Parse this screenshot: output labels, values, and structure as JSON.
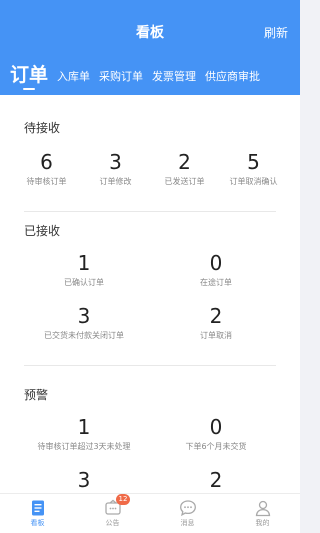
{
  "header": {
    "title": "看板",
    "right_action": "刷新"
  },
  "tabs": [
    {
      "label": "订单",
      "active": true
    },
    {
      "label": "入库单",
      "active": false
    },
    {
      "label": "采购订单",
      "active": false
    },
    {
      "label": "发票管理",
      "active": false
    },
    {
      "label": "供应商审批",
      "active": false
    }
  ],
  "pending": {
    "title": "待接收",
    "items": [
      {
        "value": "6",
        "label": "待审核订单"
      },
      {
        "value": "3",
        "label": "订单修改"
      },
      {
        "value": "2",
        "label": "已发送订单"
      },
      {
        "value": "5",
        "label": "订单取消确认"
      }
    ]
  },
  "received": {
    "title": "已接收",
    "items": [
      {
        "value": "1",
        "label": "已确认订单"
      },
      {
        "value": "0",
        "label": "在途订单"
      },
      {
        "value": "3",
        "label": "已交货未付款关闭订单"
      },
      {
        "value": "2",
        "label": "订单取消"
      }
    ]
  },
  "warning": {
    "title": "预警",
    "items": [
      {
        "value": "1",
        "label": "待审核订单超过3天未处理"
      },
      {
        "value": "0",
        "label": "下单6个月未交货"
      },
      {
        "value": "3",
        "label": ""
      },
      {
        "value": "2",
        "label": ""
      }
    ]
  },
  "bottom_nav": {
    "items": [
      {
        "label": "看板",
        "icon": "dashboard-icon",
        "active": true
      },
      {
        "label": "公告",
        "icon": "announcement-icon",
        "badge": "12"
      },
      {
        "label": "消息",
        "icon": "message-icon"
      },
      {
        "label": "我的",
        "icon": "profile-icon"
      }
    ]
  },
  "colors": {
    "primary": "#4593f5",
    "badge": "#f06a48"
  }
}
